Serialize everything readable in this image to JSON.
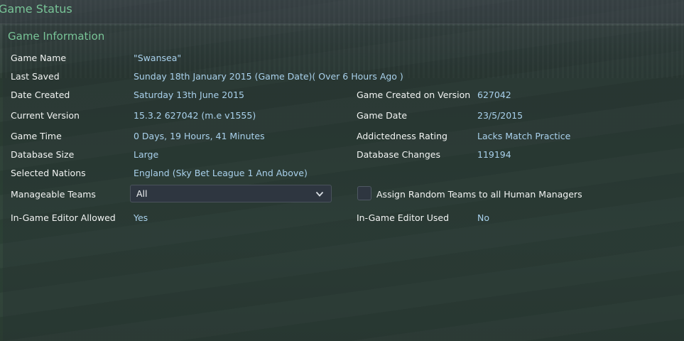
{
  "window": {
    "title": "Game Status"
  },
  "section": {
    "title": "Game Information"
  },
  "fields": {
    "game_name": {
      "label": "Game Name",
      "value": "\"Swansea\""
    },
    "last_saved": {
      "label": "Last Saved",
      "value": "Sunday 18th January 2015 (Game Date)( Over 6 Hours Ago )"
    },
    "date_created": {
      "label": "Date Created",
      "value": "Saturday 13th June 2015"
    },
    "game_created_on_version": {
      "label": "Game Created on Version",
      "value": "627042"
    },
    "current_version": {
      "label": "Current Version",
      "value": "15.3.2 627042 (m.e v1555)"
    },
    "game_date": {
      "label": "Game Date",
      "value": "23/5/2015"
    },
    "game_time": {
      "label": "Game Time",
      "value": "0 Days, 19 Hours, 41 Minutes"
    },
    "addictedness_rating": {
      "label": "Addictedness Rating",
      "value": "Lacks Match Practice"
    },
    "database_size": {
      "label": "Database Size",
      "value": "Large"
    },
    "database_changes": {
      "label": "Database Changes",
      "value": "119194"
    },
    "selected_nations": {
      "label": "Selected Nations",
      "value": "England (Sky Bet League 1 And Above)"
    },
    "manageable_teams": {
      "label": "Manageable Teams",
      "selected": "All"
    },
    "assign_random_teams": {
      "label": "Assign Random Teams to all Human Managers"
    },
    "in_game_editor_allowed": {
      "label": "In-Game Editor Allowed",
      "value": "Yes"
    },
    "in_game_editor_used": {
      "label": "In-Game Editor Used",
      "value": "No"
    }
  },
  "icons": {
    "dropdown": "chevron-down-icon",
    "checkbox": "checkbox-icon"
  },
  "colors": {
    "heading": "#78c497",
    "label": "#f2f4f3",
    "value": "#a9d1ec"
  }
}
